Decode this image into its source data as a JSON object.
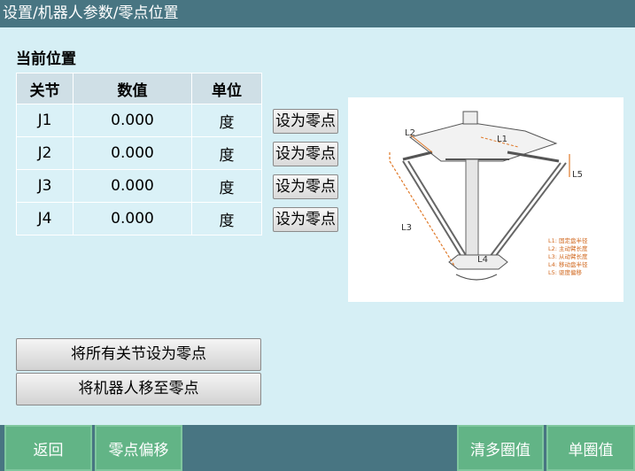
{
  "title": "设置/机器人参数/零点位置",
  "section_title": "当前位置",
  "table": {
    "headers": [
      "关节",
      "数值",
      "单位"
    ],
    "rows": [
      {
        "joint": "J1",
        "value": "0.000",
        "unit": "度"
      },
      {
        "joint": "J2",
        "value": "0.000",
        "unit": "度"
      },
      {
        "joint": "J3",
        "value": "0.000",
        "unit": "度"
      },
      {
        "joint": "J4",
        "value": "0.000",
        "unit": "度"
      }
    ]
  },
  "set_zero_label": "设为零点",
  "diagram": {
    "labels": [
      "L1",
      "L2",
      "L3",
      "L4",
      "L5"
    ],
    "legend": [
      "L1:  固定盘半径",
      "L2:  主动臂长度",
      "L3:  从动臂长度",
      "L4:  移动盘半径",
      "L5:  驱度偏移"
    ],
    "accent_color": "#e07a2a"
  },
  "actions": {
    "all_zero": "将所有关节设为零点",
    "move_zero": "将机器人移至零点"
  },
  "nav": {
    "back": "返回",
    "zero_offset": "零点偏移",
    "clear_multi": "清多圈值",
    "single_turn": "单圈值"
  }
}
